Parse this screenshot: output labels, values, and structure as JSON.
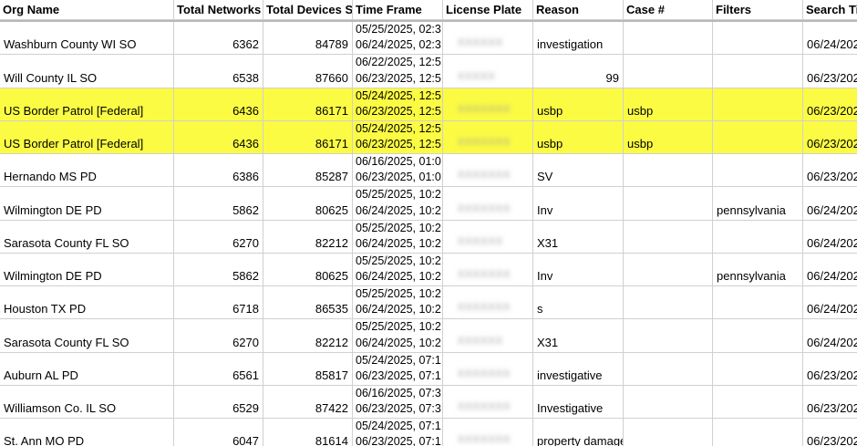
{
  "columns": [
    "Org Name",
    "Total Networks",
    "Total Devices S",
    "Time Frame",
    "License Plate",
    "Reason",
    "Case #",
    "Filters",
    "Search Ti"
  ],
  "rows": [
    {
      "org": "Washburn County WI SO",
      "networks": "6362",
      "devices": "84789",
      "tf1": "05/25/2025, 02:3",
      "tf2": "06/24/2025, 02:3",
      "plate": "XXXXXX",
      "reason": "investigation",
      "case": "",
      "filters": "",
      "search": "06/24/202",
      "highlight": false
    },
    {
      "org": "Will County IL SO",
      "networks": "6538",
      "devices": "87660",
      "tf1": "06/22/2025, 12:5",
      "tf2": "06/23/2025, 12:5",
      "plate": "XXXXX",
      "reason": "",
      "reason_num": "99",
      "case": "",
      "filters": "",
      "search": "06/23/202",
      "highlight": false
    },
    {
      "org": "US Border Patrol [Federal]",
      "networks": "6436",
      "devices": "86171",
      "tf1": "05/24/2025, 12:5",
      "tf2": "06/23/2025, 12:5",
      "plate": "XXXXXXX",
      "reason": "usbp",
      "case": "usbp",
      "filters": "",
      "search": "06/23/202",
      "highlight": true
    },
    {
      "org": "US Border Patrol [Federal]",
      "networks": "6436",
      "devices": "86171",
      "tf1": "05/24/2025, 12:5",
      "tf2": "06/23/2025, 12:5",
      "plate": "XXXXXXX",
      "reason": "usbp",
      "case": "usbp",
      "filters": "",
      "search": "06/23/202",
      "highlight": true
    },
    {
      "org": "Hernando MS PD",
      "networks": "6386",
      "devices": "85287",
      "tf1": "06/16/2025, 01:0",
      "tf2": "06/23/2025, 01:0",
      "plate": "XXXXXXX",
      "reason": "SV",
      "case": "",
      "filters": "",
      "search": "06/23/202",
      "highlight": false
    },
    {
      "org": "Wilmington DE PD",
      "networks": "5862",
      "devices": "80625",
      "tf1": "05/25/2025, 10:2",
      "tf2": "06/24/2025, 10:2",
      "plate": "XXXXXXX",
      "reason": "Inv",
      "case": "",
      "filters": "pennsylvania",
      "search": "06/24/202",
      "highlight": false
    },
    {
      "org": "Sarasota County FL SO",
      "networks": "6270",
      "devices": "82212",
      "tf1": "05/25/2025, 10:2",
      "tf2": "06/24/2025, 10:2",
      "plate": "XXXXXX",
      "reason": "X31",
      "case": "",
      "filters": "",
      "search": "06/24/202",
      "highlight": false
    },
    {
      "org": "Wilmington DE PD",
      "networks": "5862",
      "devices": "80625",
      "tf1": "05/25/2025, 10:2",
      "tf2": "06/24/2025, 10:2",
      "plate": "XXXXXXX",
      "reason": "Inv",
      "case": "",
      "filters": "pennsylvania",
      "search": "06/24/202",
      "highlight": false
    },
    {
      "org": "Houston TX PD",
      "networks": "6718",
      "devices": "86535",
      "tf1": "05/25/2025, 10:2",
      "tf2": "06/24/2025, 10:2",
      "plate": "XXXXXXX",
      "reason": "s",
      "case": "",
      "filters": "",
      "search": "06/24/202",
      "highlight": false
    },
    {
      "org": "Sarasota County FL SO",
      "networks": "6270",
      "devices": "82212",
      "tf1": "05/25/2025, 10:2",
      "tf2": "06/24/2025, 10:2",
      "plate": "XXXXXX",
      "reason": "X31",
      "case": "",
      "filters": "",
      "search": "06/24/202",
      "highlight": false
    },
    {
      "org": "Auburn AL PD",
      "networks": "6561",
      "devices": "85817",
      "tf1": "05/24/2025, 07:1",
      "tf2": "06/23/2025, 07:1",
      "plate": "XXXXXXX",
      "reason": "investigative",
      "case": "",
      "filters": "",
      "search": "06/23/202",
      "highlight": false
    },
    {
      "org": "Williamson Co. IL SO",
      "networks": "6529",
      "devices": "87422",
      "tf1": "06/16/2025, 07:3",
      "tf2": "06/23/2025, 07:3",
      "plate": "XXXXXXX",
      "reason": "Investigative",
      "case": "",
      "filters": "",
      "search": "06/23/202",
      "highlight": false
    },
    {
      "org": "St. Ann MO PD",
      "networks": "6047",
      "devices": "81614",
      "tf1": "05/24/2025, 07:1",
      "tf2": "06/23/2025, 07:1",
      "plate": "XXXXXXX",
      "reason": "property damage",
      "case": "",
      "filters": "",
      "search": "06/23/202",
      "highlight": false
    }
  ],
  "colors": {
    "highlight": "#fbfb44",
    "grid": "#d0d0d0"
  }
}
